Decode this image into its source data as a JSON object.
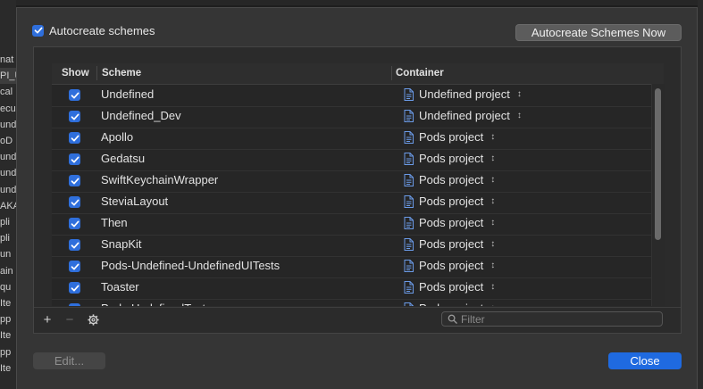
{
  "sidebar_fragments": [
    "nat",
    "PI_U",
    "cal",
    "ecu",
    "und",
    "oD",
    "und",
    "und",
    "und",
    "AKA",
    "pli",
    "pli",
    "un",
    "ain",
    "qu",
    "Ite",
    "pp",
    "Ite",
    "pp",
    "Ite"
  ],
  "autocreate": {
    "label": "Autocreate schemes",
    "checked": true
  },
  "autocreate_now_label": "Autocreate Schemes Now",
  "table": {
    "headers": {
      "show": "Show",
      "scheme": "Scheme",
      "container": "Container"
    },
    "rows": [
      {
        "show": true,
        "scheme": "Undefined",
        "container": "Undefined project"
      },
      {
        "show": true,
        "scheme": "Undefined_Dev",
        "container": "Undefined project"
      },
      {
        "show": true,
        "scheme": "Apollo",
        "container": "Pods project"
      },
      {
        "show": true,
        "scheme": "Gedatsu",
        "container": "Pods project"
      },
      {
        "show": true,
        "scheme": "SwiftKeychainWrapper",
        "container": "Pods project"
      },
      {
        "show": true,
        "scheme": "SteviaLayout",
        "container": "Pods project"
      },
      {
        "show": true,
        "scheme": "Then",
        "container": "Pods project"
      },
      {
        "show": true,
        "scheme": "SnapKit",
        "container": "Pods project"
      },
      {
        "show": true,
        "scheme": "Pods-Undefined-UndefinedUITests",
        "container": "Pods project"
      },
      {
        "show": true,
        "scheme": "Toaster",
        "container": "Pods project"
      },
      {
        "show": true,
        "scheme": "Pods-UndefinedTests",
        "container": "Pods project"
      }
    ]
  },
  "toolbar": {
    "add": "+",
    "remove": "−",
    "settings_icon": "gear-icon"
  },
  "filter": {
    "placeholder": "Filter",
    "value": ""
  },
  "buttons": {
    "edit": "Edit...",
    "close": "Close"
  },
  "colors": {
    "accent": "#1f6ae0",
    "checkbox": "#2f6fdc",
    "doc_icon": "#6b9be8"
  }
}
